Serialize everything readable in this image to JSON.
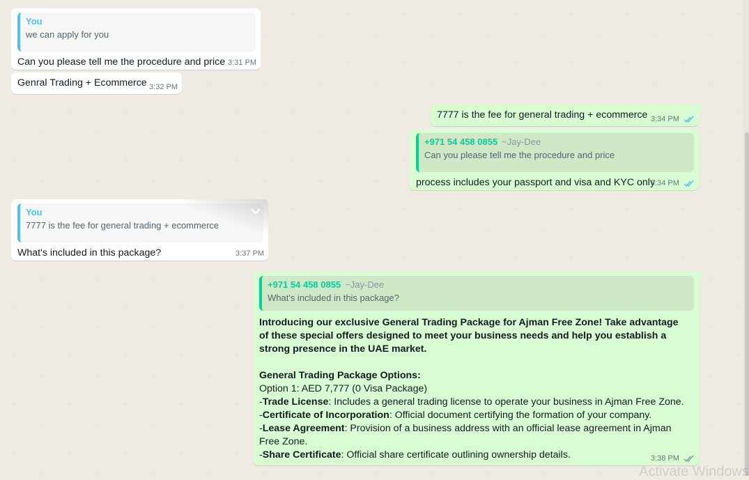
{
  "messages": [
    {
      "quote": {
        "author": "You",
        "text": "we can apply for you"
      },
      "text": "Can you please tell me the procedure and price",
      "time": "3:31 PM"
    },
    {
      "text": "Genral Trading + Ecommerce",
      "time": "3:32 PM"
    },
    {
      "text": "7777 is the fee for general trading + ecommerce",
      "time": "3:34 PM"
    },
    {
      "quote": {
        "author": "+971 54 458 0855",
        "pushname": "~Jay-Dee",
        "text": "Can you please tell me the procedure and price"
      },
      "text": "process includes your passport and visa and KYC only",
      "time": "3:34 PM"
    },
    {
      "quote": {
        "author": "You",
        "text": "7777 is the fee for general trading + ecommerce"
      },
      "text": "What's included in this package?",
      "time": "3:37 PM"
    },
    {
      "quote": {
        "author": "+971 54 458 0855",
        "pushname": "~Jay-Dee",
        "text": "What's included in this package?"
      },
      "intro": "Introducing our exclusive General Trading Package for Ajman Free Zone! Take advantage of these special offers designed to meet your business needs and help you establish a strong presence in the UAE market.",
      "options_heading": "General Trading Package Options:",
      "option1": "Option 1: AED 7,777 (0 Visa Package)",
      "items": [
        {
          "label": "Trade License",
          "desc": ": Includes a general trading license to operate your business in Ajman Free Zone."
        },
        {
          "label": "Certificate of Incorporation",
          "desc": ": Official document certifying the formation of your company."
        },
        {
          "label": "Lease Agreement",
          "desc": ": Provision of a business address with an official lease agreement in Ajman Free Zone."
        },
        {
          "label": "Share Certificate",
          "desc": ": Official share certificate outlining ownership details."
        }
      ],
      "time": "3:38 PM"
    }
  ],
  "watermark": "Activate Windows",
  "colors": {
    "background": "#efeae2",
    "incoming": "#ffffff",
    "outgoing": "#d9fdd3",
    "quote_you": "#53bdeb",
    "quote_contact": "#06cf9c",
    "read_ticks": "#53bdeb"
  },
  "icons": [
    "double-check-icon",
    "chevron-down-icon"
  ]
}
